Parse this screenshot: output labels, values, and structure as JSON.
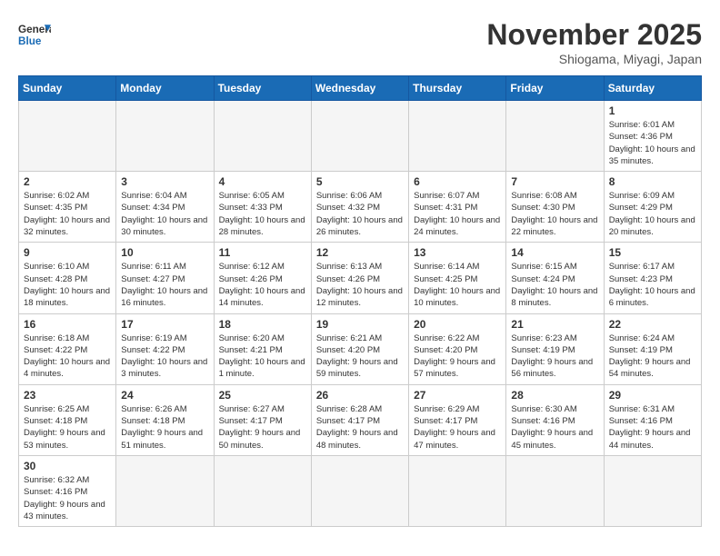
{
  "header": {
    "logo_general": "General",
    "logo_blue": "Blue",
    "month_year": "November 2025",
    "location": "Shiogama, Miyagi, Japan"
  },
  "weekdays": [
    "Sunday",
    "Monday",
    "Tuesday",
    "Wednesday",
    "Thursday",
    "Friday",
    "Saturday"
  ],
  "weeks": [
    [
      {
        "day": "",
        "info": ""
      },
      {
        "day": "",
        "info": ""
      },
      {
        "day": "",
        "info": ""
      },
      {
        "day": "",
        "info": ""
      },
      {
        "day": "",
        "info": ""
      },
      {
        "day": "",
        "info": ""
      },
      {
        "day": "1",
        "info": "Sunrise: 6:01 AM\nSunset: 4:36 PM\nDaylight: 10 hours and 35 minutes."
      }
    ],
    [
      {
        "day": "2",
        "info": "Sunrise: 6:02 AM\nSunset: 4:35 PM\nDaylight: 10 hours and 32 minutes."
      },
      {
        "day": "3",
        "info": "Sunrise: 6:04 AM\nSunset: 4:34 PM\nDaylight: 10 hours and 30 minutes."
      },
      {
        "day": "4",
        "info": "Sunrise: 6:05 AM\nSunset: 4:33 PM\nDaylight: 10 hours and 28 minutes."
      },
      {
        "day": "5",
        "info": "Sunrise: 6:06 AM\nSunset: 4:32 PM\nDaylight: 10 hours and 26 minutes."
      },
      {
        "day": "6",
        "info": "Sunrise: 6:07 AM\nSunset: 4:31 PM\nDaylight: 10 hours and 24 minutes."
      },
      {
        "day": "7",
        "info": "Sunrise: 6:08 AM\nSunset: 4:30 PM\nDaylight: 10 hours and 22 minutes."
      },
      {
        "day": "8",
        "info": "Sunrise: 6:09 AM\nSunset: 4:29 PM\nDaylight: 10 hours and 20 minutes."
      }
    ],
    [
      {
        "day": "9",
        "info": "Sunrise: 6:10 AM\nSunset: 4:28 PM\nDaylight: 10 hours and 18 minutes."
      },
      {
        "day": "10",
        "info": "Sunrise: 6:11 AM\nSunset: 4:27 PM\nDaylight: 10 hours and 16 minutes."
      },
      {
        "day": "11",
        "info": "Sunrise: 6:12 AM\nSunset: 4:26 PM\nDaylight: 10 hours and 14 minutes."
      },
      {
        "day": "12",
        "info": "Sunrise: 6:13 AM\nSunset: 4:26 PM\nDaylight: 10 hours and 12 minutes."
      },
      {
        "day": "13",
        "info": "Sunrise: 6:14 AM\nSunset: 4:25 PM\nDaylight: 10 hours and 10 minutes."
      },
      {
        "day": "14",
        "info": "Sunrise: 6:15 AM\nSunset: 4:24 PM\nDaylight: 10 hours and 8 minutes."
      },
      {
        "day": "15",
        "info": "Sunrise: 6:17 AM\nSunset: 4:23 PM\nDaylight: 10 hours and 6 minutes."
      }
    ],
    [
      {
        "day": "16",
        "info": "Sunrise: 6:18 AM\nSunset: 4:22 PM\nDaylight: 10 hours and 4 minutes."
      },
      {
        "day": "17",
        "info": "Sunrise: 6:19 AM\nSunset: 4:22 PM\nDaylight: 10 hours and 3 minutes."
      },
      {
        "day": "18",
        "info": "Sunrise: 6:20 AM\nSunset: 4:21 PM\nDaylight: 10 hours and 1 minute."
      },
      {
        "day": "19",
        "info": "Sunrise: 6:21 AM\nSunset: 4:20 PM\nDaylight: 9 hours and 59 minutes."
      },
      {
        "day": "20",
        "info": "Sunrise: 6:22 AM\nSunset: 4:20 PM\nDaylight: 9 hours and 57 minutes."
      },
      {
        "day": "21",
        "info": "Sunrise: 6:23 AM\nSunset: 4:19 PM\nDaylight: 9 hours and 56 minutes."
      },
      {
        "day": "22",
        "info": "Sunrise: 6:24 AM\nSunset: 4:19 PM\nDaylight: 9 hours and 54 minutes."
      }
    ],
    [
      {
        "day": "23",
        "info": "Sunrise: 6:25 AM\nSunset: 4:18 PM\nDaylight: 9 hours and 53 minutes."
      },
      {
        "day": "24",
        "info": "Sunrise: 6:26 AM\nSunset: 4:18 PM\nDaylight: 9 hours and 51 minutes."
      },
      {
        "day": "25",
        "info": "Sunrise: 6:27 AM\nSunset: 4:17 PM\nDaylight: 9 hours and 50 minutes."
      },
      {
        "day": "26",
        "info": "Sunrise: 6:28 AM\nSunset: 4:17 PM\nDaylight: 9 hours and 48 minutes."
      },
      {
        "day": "27",
        "info": "Sunrise: 6:29 AM\nSunset: 4:17 PM\nDaylight: 9 hours and 47 minutes."
      },
      {
        "day": "28",
        "info": "Sunrise: 6:30 AM\nSunset: 4:16 PM\nDaylight: 9 hours and 45 minutes."
      },
      {
        "day": "29",
        "info": "Sunrise: 6:31 AM\nSunset: 4:16 PM\nDaylight: 9 hours and 44 minutes."
      }
    ],
    [
      {
        "day": "30",
        "info": "Sunrise: 6:32 AM\nSunset: 4:16 PM\nDaylight: 9 hours and 43 minutes."
      },
      {
        "day": "",
        "info": ""
      },
      {
        "day": "",
        "info": ""
      },
      {
        "day": "",
        "info": ""
      },
      {
        "day": "",
        "info": ""
      },
      {
        "day": "",
        "info": ""
      },
      {
        "day": "",
        "info": ""
      }
    ]
  ]
}
